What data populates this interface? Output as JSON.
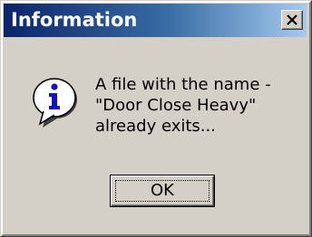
{
  "window": {
    "title": "Information",
    "close_icon": "close-icon"
  },
  "message": {
    "icon": "information-icon",
    "lines": [
      "A file with the name -",
      "\"Door Close Heavy\"",
      "already exits..."
    ]
  },
  "buttons": {
    "ok_label": "OK"
  },
  "colors": {
    "titlebar_start": "#0a246a",
    "titlebar_end": "#a6caf0",
    "dialog_face": "#d4d0c8",
    "info_blue": "#1010c0"
  }
}
